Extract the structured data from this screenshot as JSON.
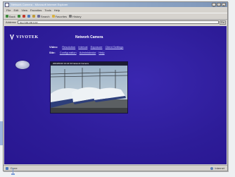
{
  "window": {
    "title": "Network Camera - Microsoft Internet Explorer",
    "buttons": {
      "minimize": "_",
      "maximize": "□",
      "close": "×"
    }
  },
  "menu": [
    "File",
    "Edit",
    "View",
    "Favorites",
    "Tools",
    "Help"
  ],
  "toolbar": {
    "back": "Back",
    "forward": "",
    "stop": "",
    "refresh": "",
    "home": "",
    "search": "Search",
    "favorites": "Favorites",
    "history": "History"
  },
  "address": {
    "label": "Address",
    "value": "http://192.168.0.20/",
    "go": "Go"
  },
  "page": {
    "logo_text": "VIVOTEK",
    "title": "Network Camera",
    "row1": {
      "label": "Video:",
      "items": [
        "Resolution",
        "Interval",
        "Exposure",
        "Client Settings"
      ]
    },
    "row2": {
      "label": "Site:",
      "items": [
        "Configuration",
        "Administrator",
        "Help"
      ]
    },
    "camera_caption": "2004/06/16 10:22:33 Network Camera"
  },
  "status": {
    "left": "Done",
    "zone": "Internet"
  },
  "colors": {
    "page_bg": "#2f1e9a",
    "chrome": "#d6d3ce",
    "title_bar": "#8fa7c7"
  },
  "icons": {
    "logo": "vivotek-logo-icon",
    "side_button": "snapshot-button-icon"
  }
}
